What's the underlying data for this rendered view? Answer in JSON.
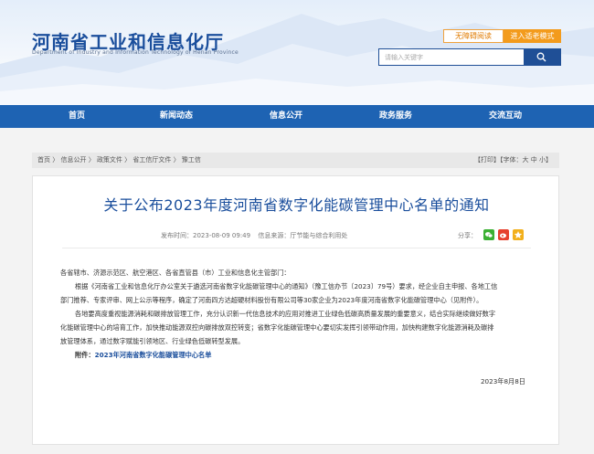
{
  "header": {
    "site_title": "河南省工业和信息化厅",
    "site_subtitle": "Department of Industry and Information Technology of Henan Province",
    "barrier_free": "无障碍阅读",
    "elder_mode": "进入适老模式",
    "search_placeholder": "请输入关键字",
    "search_icon": "search-icon"
  },
  "nav": {
    "items": [
      {
        "label": "首页"
      },
      {
        "label": "新闻动态"
      },
      {
        "label": "信息公开"
      },
      {
        "label": "政务服务"
      },
      {
        "label": "交流互动"
      }
    ]
  },
  "breadcrumb": {
    "items": [
      "首页",
      "信息公开",
      "政策文件",
      "省工信厅文件",
      "豫工信"
    ],
    "separator": "〉",
    "tools": "【打印】【字体：大 中 小】"
  },
  "article": {
    "title": "关于公布2023年度河南省数字化能碳管理中心名单的通知",
    "publish_time": "发布时间：2023-08-09  09:49",
    "source": "信息来源：厅节能与综合利用处",
    "share_label": "分享：",
    "paragraphs": [
      "各省辖市、济源示范区、航空港区、各省直管县（市）工业和信息化主管部门：",
      "根据《河南省工业和信息化厅办公室关于遴选河南省数字化能碳管理中心的通知》（豫工信办节〔2023〕79号）要求，经企业自主申报、各地工信",
      "部门推荐、专家评审、网上公示等程序，确定了河南四方达超硬材料股份有限公司等30家企业为2023年度河南省数字化能碳管理中心（见附件）。",
      "各地要高度重视能源消耗和碳排放管理工作，充分认识新一代信息技术的应用对推进工业绿色低碳高质量发展的重要意义，结合实际继续做好数字",
      "化能碳管理中心的培育工作，加快推动能源双控向碳排放双控转变；省数字化能碳管理中心要切实发挥引领带动作用，加快构建数字化能源消耗及碳排",
      "放管理体系，通过数字赋能引领地区、行业绿色低碳转型发展。"
    ],
    "attachment_label": "附件：",
    "attachment_link": "2023年河南省数字化能碳管理中心名单",
    "date": "2023年8月8日"
  },
  "colors": {
    "brand_blue": "#1e63b3",
    "title_blue": "#1a4e9c",
    "accent_orange": "#f39b1c"
  }
}
